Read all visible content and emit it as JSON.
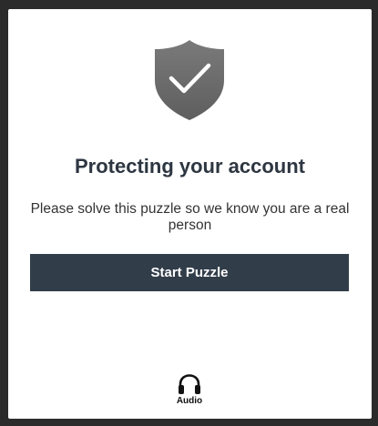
{
  "challenge": {
    "icon": "shield-check-icon",
    "title": "Protecting your account",
    "subtitle": "Please solve this puzzle so we know you are a real person",
    "start_button_label": "Start Puzzle",
    "audio_icon": "headphones-icon",
    "audio_label": "Audio",
    "colors": {
      "shield": "#6f6f6f",
      "title": "#2d3641",
      "button_bg": "#323d4a",
      "button_text": "#ffffff",
      "frame": "#2b2b2b"
    }
  }
}
